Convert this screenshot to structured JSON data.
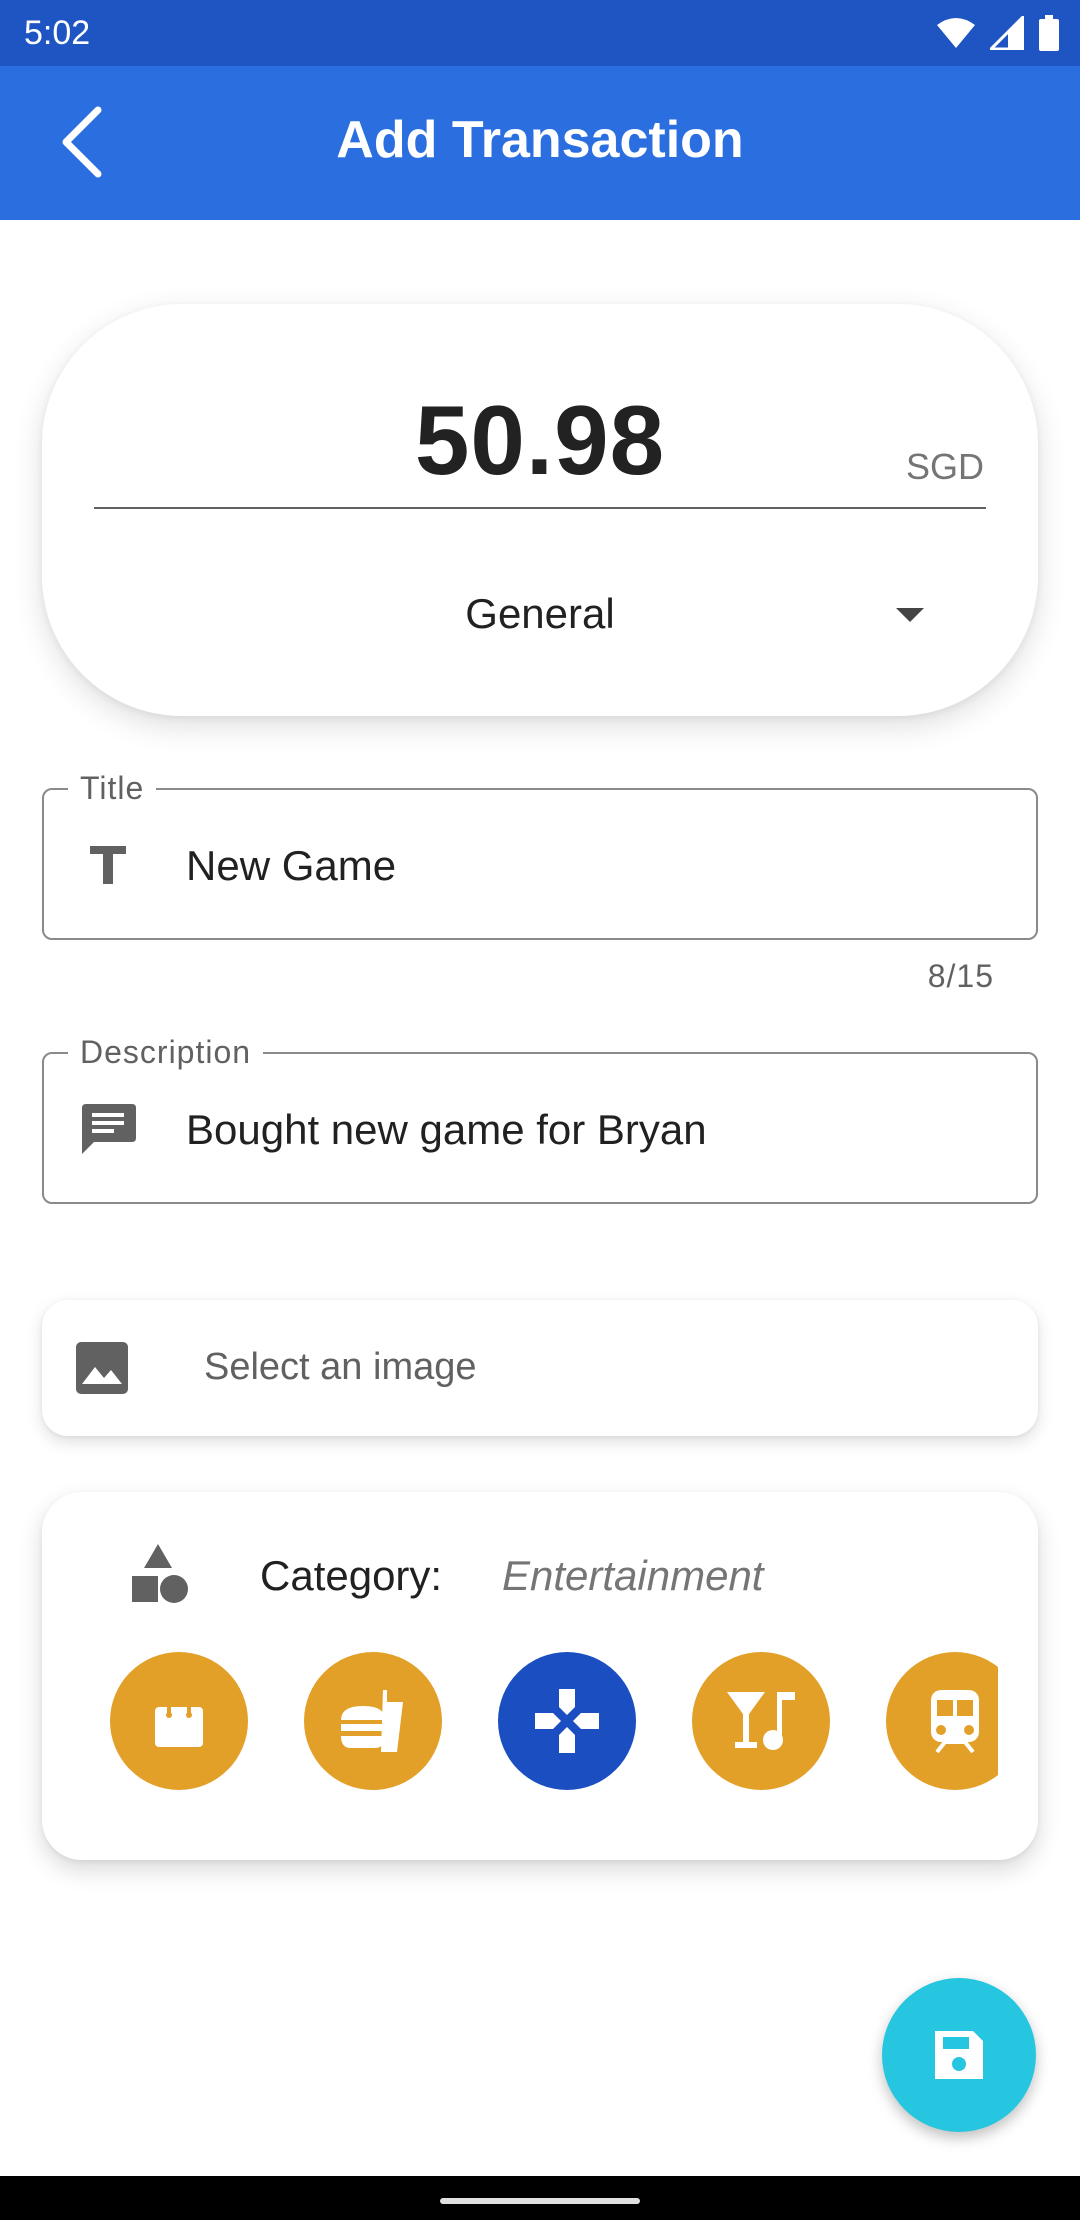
{
  "status_bar": {
    "time": "5:02",
    "icons": [
      "wifi-icon",
      "signal-icon",
      "battery-icon"
    ]
  },
  "app_bar": {
    "title": "Add Transaction",
    "back_icon": "arrow-back-icon"
  },
  "amount": {
    "value": "50.98",
    "currency": "SGD",
    "account": "General"
  },
  "title_field": {
    "label": "Title",
    "value": "New Game",
    "icon": "text-title-icon",
    "counter": "8/15"
  },
  "description_field": {
    "label": "Description",
    "value": "Bought new game for Bryan",
    "icon": "comment-text-icon"
  },
  "image_selector": {
    "label": "Select an image",
    "icon": "image-icon"
  },
  "category": {
    "label": "Category:",
    "value": "Entertainment",
    "icon": "shapes-icon",
    "options": [
      {
        "name": "shopping-bag-icon",
        "selected": false
      },
      {
        "name": "fastfood-icon",
        "selected": false
      },
      {
        "name": "gamepad-icon",
        "selected": true
      },
      {
        "name": "nightlife-icon",
        "selected": false
      },
      {
        "name": "train-icon",
        "selected": false
      }
    ]
  },
  "fab": {
    "icon": "save-icon"
  },
  "colors": {
    "status_bar": "#1e55c3",
    "app_bar": "#2a6ee0",
    "category_default": "#e3a028",
    "category_selected": "#1b4fc1",
    "fab": "#26c6e0"
  }
}
